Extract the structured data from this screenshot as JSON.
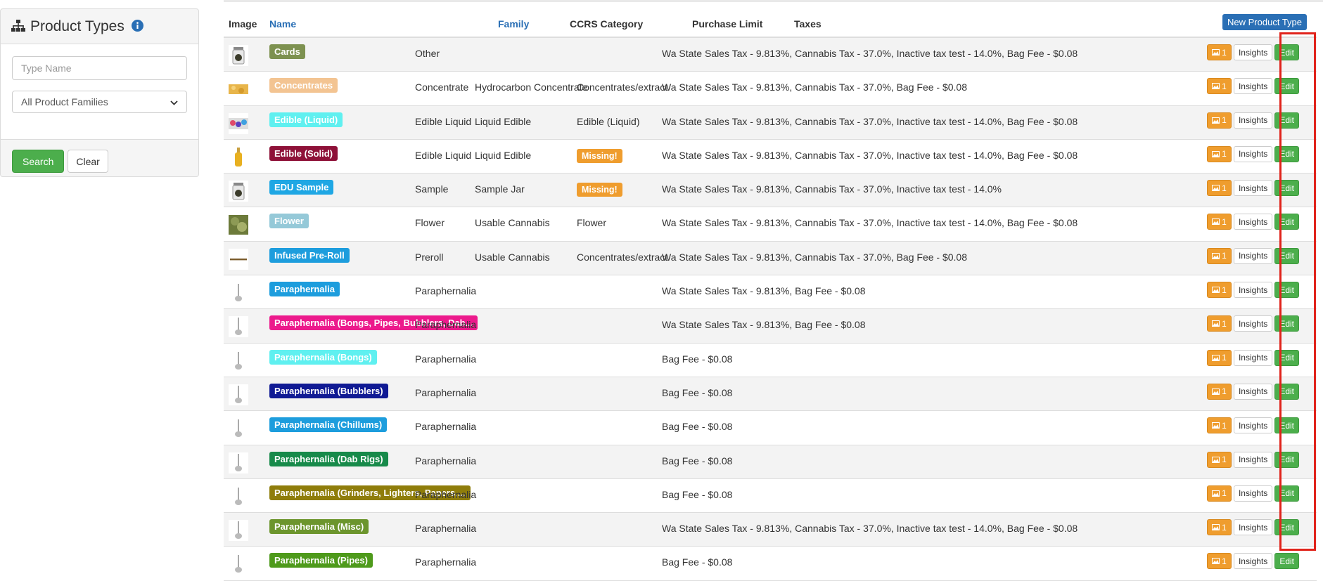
{
  "sidebar": {
    "title": "Product Types",
    "search_placeholder": "Type Name",
    "family_select": "All Product Families",
    "search_label": "Search",
    "clear_label": "Clear"
  },
  "table": {
    "headers": {
      "image": "Image",
      "name": "Name",
      "family": "Family",
      "ccrs": "CCRS Category",
      "limit": "Purchase Limit",
      "taxes": "Taxes"
    },
    "new_button": "New Product Type",
    "action_labels": {
      "image_count": "1",
      "insights": "Insights",
      "edit": "Edit"
    },
    "rows": [
      {
        "name": "Cards",
        "color": "#7d9150",
        "family": "Other",
        "ccrs": "",
        "limit": "",
        "missing": false,
        "taxes": "Wa State Sales Tax - 9.813%, Cannabis Tax - 37.0%, Inactive tax test - 14.0%, Bag Fee - $0.08",
        "thumb": "jar"
      },
      {
        "name": "Concentrates",
        "color": "#f3c492",
        "family": "Concentrate",
        "ccrs": "Hydrocarbon Concentrate",
        "limit": "Concentrates/extract",
        "missing": false,
        "taxes": "Wa State Sales Tax - 9.813%, Cannabis Tax - 37.0%, Bag Fee - $0.08",
        "thumb": "concentrate"
      },
      {
        "name": "Edible (Liquid)",
        "color": "#5ff0f0",
        "family": "Edible Liquid",
        "ccrs": "Liquid Edible",
        "limit": "Edible (Liquid)",
        "missing": false,
        "taxes": "Wa State Sales Tax - 9.813%, Cannabis Tax - 37.0%, Inactive tax test - 14.0%, Bag Fee - $0.08",
        "thumb": "edible"
      },
      {
        "name": "Edible (Solid)",
        "color": "#8e1138",
        "family": "Edible Liquid",
        "ccrs": "Liquid Edible",
        "limit": "Missing!",
        "missing": true,
        "taxes": "Wa State Sales Tax - 9.813%, Cannabis Tax - 37.0%, Inactive tax test - 14.0%, Bag Fee - $0.08",
        "thumb": "bottle"
      },
      {
        "name": "EDU Sample",
        "color": "#1fa7e4",
        "family": "Sample",
        "ccrs": "Sample Jar",
        "limit": "Missing!",
        "missing": true,
        "taxes": "Wa State Sales Tax - 9.813%, Cannabis Tax - 37.0%, Inactive tax test - 14.0%",
        "thumb": "jar"
      },
      {
        "name": "Flower",
        "color": "#95c9d8",
        "family": "Flower",
        "ccrs": "Usable Cannabis",
        "limit": "Flower",
        "missing": false,
        "taxes": "Wa State Sales Tax - 9.813%, Cannabis Tax - 37.0%, Inactive tax test - 14.0%, Bag Fee - $0.08",
        "thumb": "flower"
      },
      {
        "name": "Infused Pre-Roll",
        "color": "#1d9ddd",
        "family": "Preroll",
        "ccrs": "Usable Cannabis",
        "limit": "Concentrates/extract",
        "missing": false,
        "taxes": "Wa State Sales Tax - 9.813%, Cannabis Tax - 37.0%, Bag Fee - $0.08",
        "thumb": "preroll"
      },
      {
        "name": "Paraphernalia",
        "color": "#1d9ddd",
        "family": "Paraphernalia",
        "ccrs": "",
        "limit": "",
        "missing": false,
        "taxes": "Wa State Sales Tax - 9.813%, Bag Fee - $0.08",
        "thumb": "pipe"
      },
      {
        "name": "Paraphernalia (Bongs, Pipes, Bubblers, Dab...",
        "color": "#ec1a8c",
        "family": "Paraphernalia",
        "ccrs": "",
        "limit": "",
        "missing": false,
        "taxes": "Wa State Sales Tax - 9.813%, Bag Fee - $0.08",
        "thumb": "pipe"
      },
      {
        "name": "Paraphernalia (Bongs)",
        "color": "#5ff0f0",
        "family": "Paraphernalia",
        "ccrs": "",
        "limit": "",
        "missing": false,
        "taxes": "Bag Fee - $0.08",
        "thumb": "pipe"
      },
      {
        "name": "Paraphernalia (Bubblers)",
        "color": "#101a94",
        "family": "Paraphernalia",
        "ccrs": "",
        "limit": "",
        "missing": false,
        "taxes": "Bag Fee - $0.08",
        "thumb": "pipe"
      },
      {
        "name": "Paraphernalia (Chillums)",
        "color": "#1d9ddd",
        "family": "Paraphernalia",
        "ccrs": "",
        "limit": "",
        "missing": false,
        "taxes": "Bag Fee - $0.08",
        "thumb": "pipe"
      },
      {
        "name": "Paraphernalia (Dab Rigs)",
        "color": "#178a4a",
        "family": "Paraphernalia",
        "ccrs": "",
        "limit": "",
        "missing": false,
        "taxes": "Bag Fee - $0.08",
        "thumb": "pipe"
      },
      {
        "name": "Paraphernalia (Grinders, Lighters, Papers,...",
        "color": "#8f7d0b",
        "family": "Paraphernalia",
        "ccrs": "",
        "limit": "",
        "missing": false,
        "taxes": "Bag Fee - $0.08",
        "thumb": "pipe"
      },
      {
        "name": "Paraphernalia (Misc)",
        "color": "#6c952d",
        "family": "Paraphernalia",
        "ccrs": "",
        "limit": "",
        "missing": false,
        "taxes": "Wa State Sales Tax - 9.813%, Cannabis Tax - 37.0%, Inactive tax test - 14.0%, Bag Fee - $0.08",
        "thumb": "pipe"
      },
      {
        "name": "Paraphernalia (Pipes)",
        "color": "#4e9a1b",
        "family": "Paraphernalia",
        "ccrs": "",
        "limit": "",
        "missing": false,
        "taxes": "Bag Fee - $0.08",
        "thumb": "pipe"
      }
    ]
  }
}
